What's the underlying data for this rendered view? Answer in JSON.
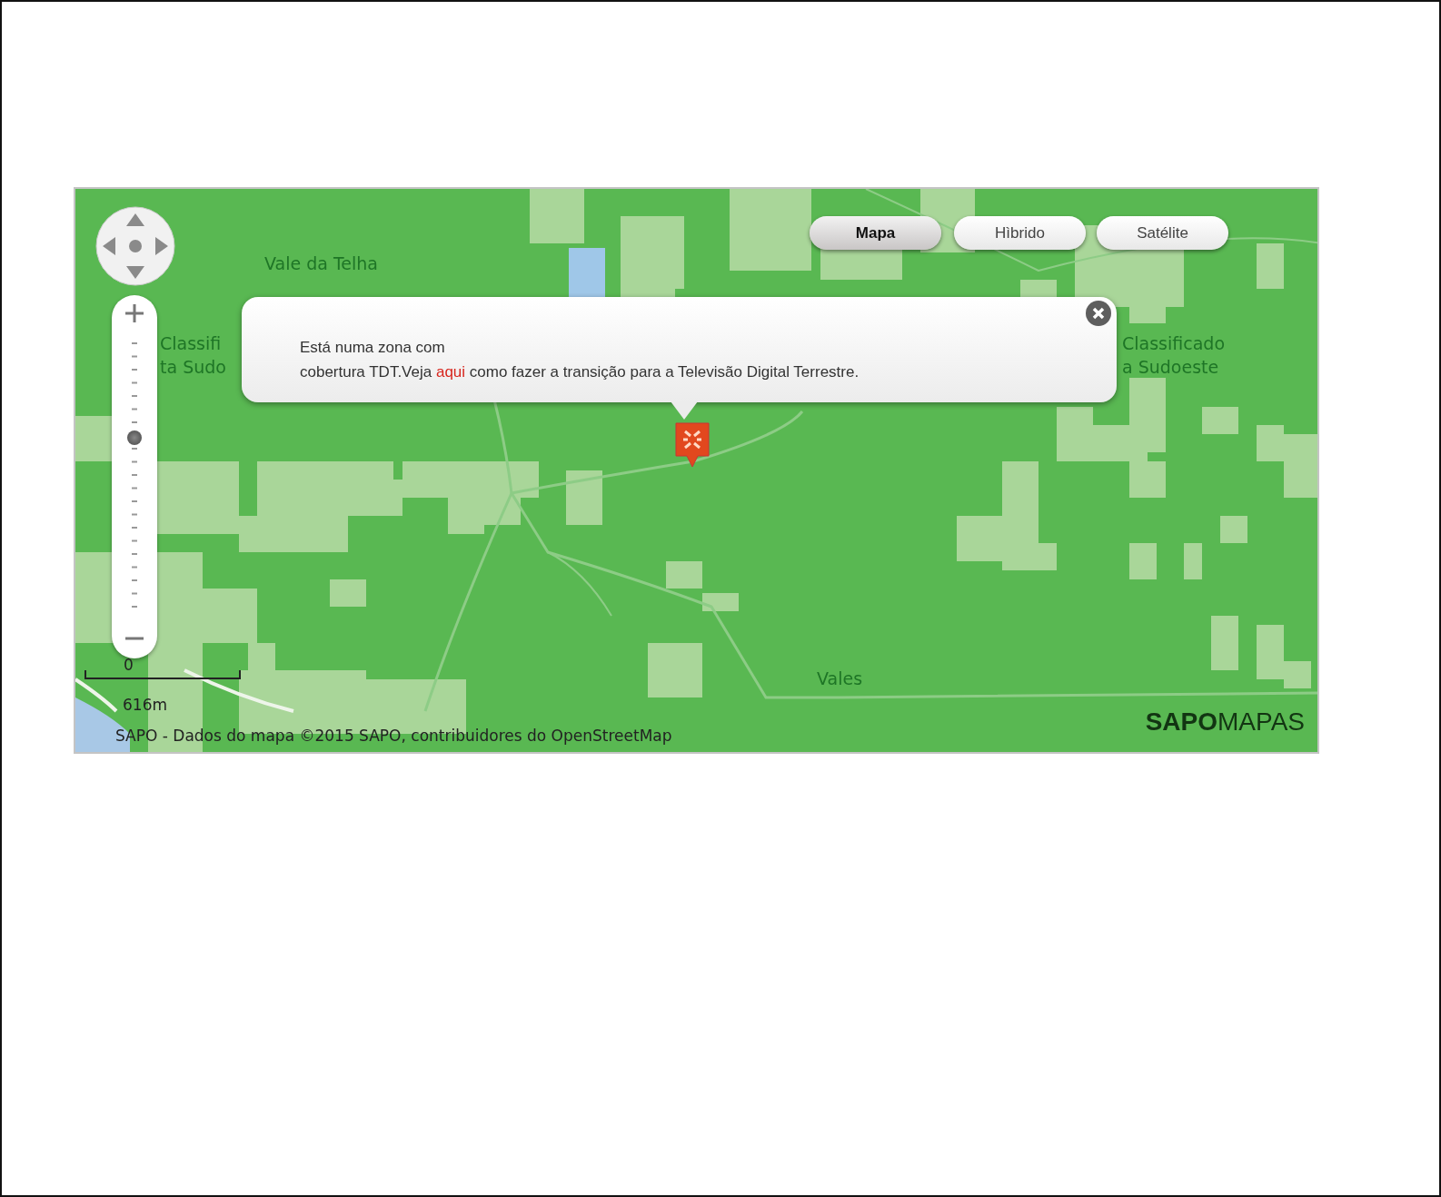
{
  "map_types": [
    {
      "label": "Mapa",
      "selected": true
    },
    {
      "label": "Hìbrido",
      "selected": false
    },
    {
      "label": "Satélite",
      "selected": false
    }
  ],
  "zoom": {
    "level": 0.64
  },
  "popup": {
    "line1": "Está numa zona com",
    "before": "cobertura TDT.Veja ",
    "link": "aqui",
    "after": " como fazer a transição para a Televisão Digital Terrestre."
  },
  "place_labels": [
    {
      "text": "Vale da Telha"
    },
    {
      "text": "Classifi"
    },
    {
      "text": "ta Sudo"
    },
    {
      "text": "Classificado"
    },
    {
      "text": "a Sudoeste"
    },
    {
      "text": "Vales"
    }
  ],
  "scale": {
    "start": "0",
    "distance": "616m"
  },
  "attribution": "SAPO - Dados do mapa ©2015 SAPO, contribuidores do OpenStreetMap",
  "logo": "**SAPO**MAPAS"
}
